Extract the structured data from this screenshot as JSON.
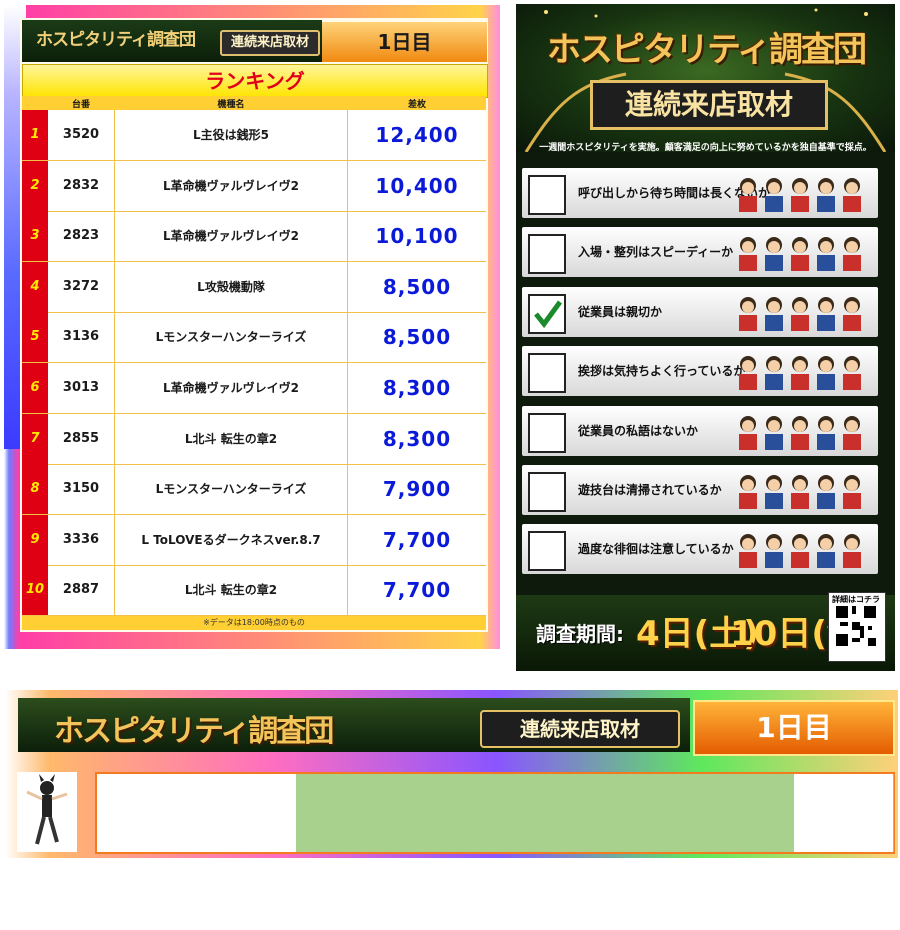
{
  "ranking_panel": {
    "title_main": "ホスピタリティ調査団",
    "title_tag": "連続来店取材",
    "day": "1日目",
    "header": "ランキング",
    "columns": [
      "台番",
      "機種名",
      "差枚"
    ],
    "rows": [
      {
        "rank": "1",
        "number": "3520",
        "machine": "L主役は銭形5",
        "diff": "12,400"
      },
      {
        "rank": "2",
        "number": "2832",
        "machine": "L革命機ヴァルヴレイヴ2",
        "diff": "10,400"
      },
      {
        "rank": "3",
        "number": "2823",
        "machine": "L革命機ヴァルヴレイヴ2",
        "diff": "10,100"
      },
      {
        "rank": "4",
        "number": "3272",
        "machine": "L攻殻機動隊",
        "diff": "8,500"
      },
      {
        "rank": "5",
        "number": "3136",
        "machine": "Lモンスターハンターライズ",
        "diff": "8,500"
      },
      {
        "rank": "6",
        "number": "3013",
        "machine": "L革命機ヴァルヴレイヴ2",
        "diff": "8,300"
      },
      {
        "rank": "7",
        "number": "2855",
        "machine": "L北斗 転生の章2",
        "diff": "8,300"
      },
      {
        "rank": "8",
        "number": "3150",
        "machine": "Lモンスターハンターライズ",
        "diff": "7,900"
      },
      {
        "rank": "9",
        "number": "3336",
        "machine": "L ToLOVEるダークネスver.8.7",
        "diff": "7,700"
      },
      {
        "rank": "10",
        "number": "2887",
        "machine": "L北斗 転生の章2",
        "diff": "7,700"
      }
    ],
    "footnote": "※データは18:00時点のもの"
  },
  "poster": {
    "title_main": "ホスピタリティ調査団",
    "title_tag": "連続来店取材",
    "subtitle": "一週間ホスピタリティを実施。顧客満足の向上に努めているかを独自基準で採点。",
    "checklist": [
      {
        "text": "呼び出しから待ち時間は長くないか",
        "checked": false
      },
      {
        "text": "入場・整列はスピーディーか",
        "checked": false
      },
      {
        "text": "従業員は親切か",
        "checked": true
      },
      {
        "text": "挨拶は気持ちよく行っているか",
        "checked": false
      },
      {
        "text": "従業員の私語はないか",
        "checked": false
      },
      {
        "text": "遊技台は清掃されているか",
        "checked": false
      },
      {
        "text": "過度な徘徊は注意しているか",
        "checked": false
      }
    ],
    "period_label": "調査期間:",
    "period_start": "4日(土)",
    "period_end": "10日(金)",
    "qr_label": "詳細はコチラ"
  },
  "banner": {
    "title_main": "ホスピタリティ調査団",
    "title_tag": "連続来店取材",
    "day": "1日目",
    "slots": [
      {
        "filled": false
      },
      {
        "filled": false
      },
      {
        "filled": true
      },
      {
        "filled": true
      },
      {
        "filled": true
      },
      {
        "filled": true
      },
      {
        "filled": true
      },
      {
        "filled": false
      }
    ]
  },
  "colors": {
    "rank_red": "#e00014",
    "diff_blue": "#0a1ad8",
    "gold": "#f3c45a",
    "slot_green": "#a9d18e",
    "dark_green": "#0c1f0a"
  }
}
